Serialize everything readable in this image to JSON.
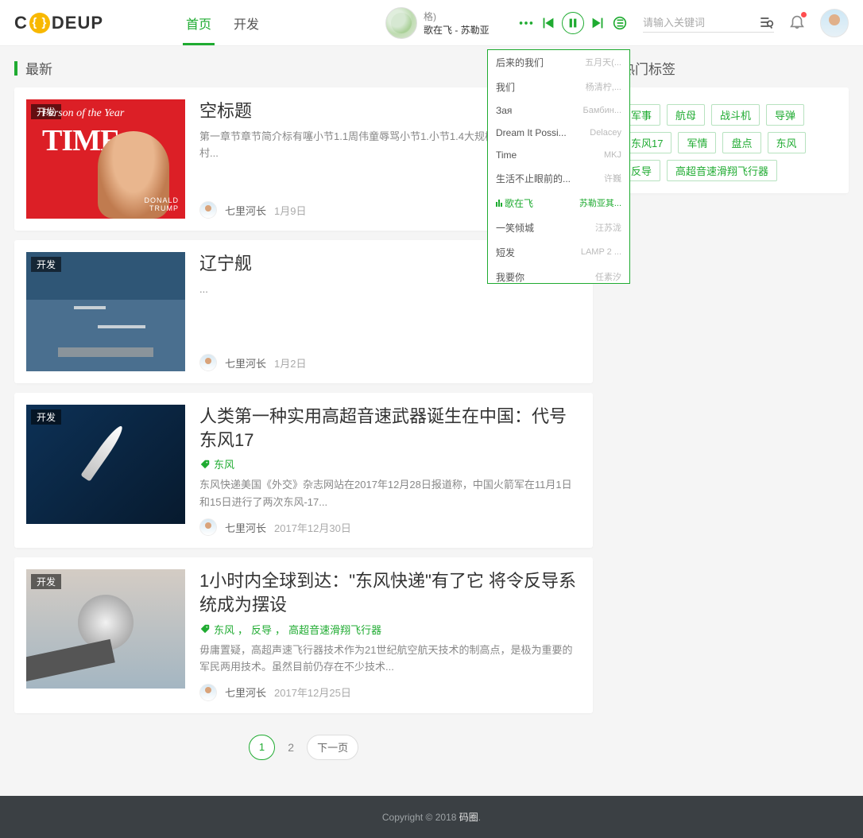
{
  "logo": {
    "c": "C",
    "code": "{ }",
    "deup": "DEUP"
  },
  "nav": {
    "home": "首页",
    "dev": "开发"
  },
  "player": {
    "line1": "格)",
    "line2": "歌在飞 - 苏勒亚",
    "playlist": [
      {
        "song": "后来的我们",
        "artist": "五月天(..."
      },
      {
        "song": "我们",
        "artist": "杨清柠,..."
      },
      {
        "song": "Зая",
        "artist": "Бамбин..."
      },
      {
        "song": "Dream It Possi...",
        "artist": "Delacey"
      },
      {
        "song": "Time",
        "artist": "MKJ"
      },
      {
        "song": "生活不止眼前的...",
        "artist": "许巍"
      },
      {
        "song": "歌在飞",
        "artist": "苏勒亚其...",
        "playing": true
      },
      {
        "song": "一笑倾城",
        "artist": "汪苏泷"
      },
      {
        "song": "短发",
        "artist": "LAMP 2 ..."
      },
      {
        "song": "我要你",
        "artist": "任素汐"
      }
    ]
  },
  "search": {
    "placeholder": "请输入关键词"
  },
  "section": {
    "latest": "最新",
    "hotTags": "热门标签"
  },
  "articles": [
    {
      "badge": "开发",
      "title": "空标题",
      "tags": [],
      "desc": "第一章节章节简介标有噻小节1.1周伟童辱骂小节1.小节1.4大规模第二章节小节2.1村...",
      "author": "七里河长",
      "date": "1月9日",
      "thumb": "th1"
    },
    {
      "badge": "开发",
      "title": "辽宁舰",
      "tags": [],
      "desc": "...",
      "author": "七里河长",
      "date": "1月2日",
      "thumb": "th2"
    },
    {
      "badge": "开发",
      "title": "人类第一种实用高超音速武器诞生在中国：代号东风17",
      "tags": [
        "东风"
      ],
      "desc": "东风快递美国《外交》杂志网站在2017年12月28日报道称，中国火箭军在11月1日和15日进行了两次东风-17...",
      "author": "七里河长",
      "date": "2017年12月30日",
      "thumb": "th3"
    },
    {
      "badge": "开发",
      "title": "1小时内全球到达：\"东风快递\"有了它 将令反导系统成为摆设",
      "tags": [
        "东风",
        "反导",
        "高超音速滑翔飞行器"
      ],
      "desc": "毋庸置疑，高超声速飞行器技术作为21世纪航空航天技术的制高点，是极为重要的军民两用技术。虽然目前仍存在不少技术...",
      "author": "七里河长",
      "date": "2017年12月25日",
      "thumb": "th4"
    }
  ],
  "tagSeparator": "，",
  "pagination": {
    "current": "1",
    "p2": "2",
    "next": "下一页"
  },
  "hotTags": [
    "军事",
    "航母",
    "战斗机",
    "导弹",
    "东风17",
    "军情",
    "盘点",
    "东风",
    "反导",
    "高超音速滑翔飞行器"
  ],
  "footer": {
    "copy": "Copyright © 2018 ",
    "brand": "码圈",
    "dot": "."
  },
  "thumb1": {
    "poty": "Person of the Year",
    "time": "TIME",
    "label_ln1": "DONALD",
    "label_ln2": "TRUMP"
  }
}
